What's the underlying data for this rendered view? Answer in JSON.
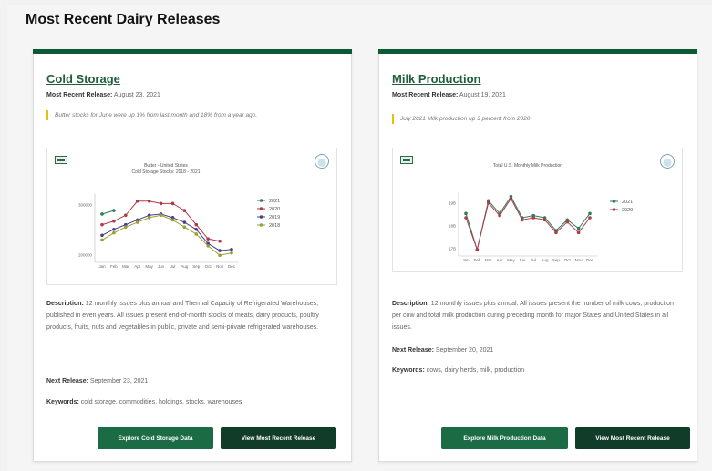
{
  "section": {
    "title": "Most Recent Dairy Releases"
  },
  "cards": [
    {
      "title": "Cold Storage",
      "release_label": "Most Recent Release:",
      "release_date": "August 23, 2021",
      "highlight": "Butter stocks for June were up 1% from last month and 18% from a year ago.",
      "description_label": "Description:",
      "description": "12 monthly issues plus annual and Thermal Capacity of Refrigerated Warehouses, published in even years. All issues present end-of-month stocks of meats, dairy products, poultry products, fruits, nuts and vegetables in public, private and semi-private refrigerated warehouses.",
      "next_release_label": "Next Release:",
      "next_release": "September 23, 2021",
      "keywords_label": "Keywords:",
      "keywords": "cold storage, commodities, holdings, stocks, warehouses",
      "explore_button": "Explore Cold Storage Data",
      "view_button": "View Most Recent Release"
    },
    {
      "title": "Milk Production",
      "release_label": "Most Recent Release:",
      "release_date": "August 19, 2021",
      "highlight": "July 2021 Milk production up 3 percent from 2020",
      "description_label": "Description:",
      "description": "12 monthly issues plus annual. All issues present the number of milk cows, production per cow and total milk production during preceding month for major States and United States in all issues.",
      "next_release_label": "Next Release:",
      "next_release": "September 20, 2021",
      "keywords_label": "Keywords:",
      "keywords": "cows, dairy herds, milk, production",
      "explore_button": "Explore Milk Production Data",
      "view_button": "View Most Recent Release"
    }
  ],
  "chart_data": [
    {
      "type": "line",
      "title": "Butter - United States",
      "subtitle": "Cold Storage Stocks: 2018 - 2021",
      "categories": [
        "Jan",
        "Feb",
        "Mar",
        "Apr",
        "May",
        "Jun",
        "Jul",
        "Aug",
        "Sep",
        "Oct",
        "Nov",
        "Dec"
      ],
      "y_ticks": [
        "300000",
        "200000"
      ],
      "series": [
        {
          "name": "2021",
          "color": "#2e7d5b",
          "values": [
            335,
            350,
            null,
            null,
            null,
            null,
            null,
            null,
            null,
            null,
            null,
            null
          ]
        },
        {
          "name": "2020",
          "color": "#b03a48",
          "values": [
            290,
            305,
            330,
            390,
            390,
            380,
            380,
            350,
            290,
            230,
            220,
            null
          ]
        },
        {
          "name": "2019",
          "color": "#4b3f8c",
          "values": [
            245,
            270,
            290,
            310,
            330,
            335,
            320,
            300,
            270,
            210,
            180,
            185
          ]
        },
        {
          "name": "2018",
          "color": "#9aa02f",
          "values": [
            225,
            255,
            280,
            300,
            320,
            330,
            310,
            280,
            250,
            200,
            160,
            170
          ]
        }
      ],
      "ylim": [
        130,
        420
      ],
      "legend": "right"
    },
    {
      "type": "line",
      "title": "Total U.S. Monthly Milk Production",
      "categories": [
        "Jan",
        "Feb",
        "Mar",
        "Apr",
        "May",
        "Jun",
        "Jul",
        "Aug",
        "Sep",
        "Oct",
        "Nov",
        "Dec"
      ],
      "y_ticks": [
        "19B",
        "18B",
        "17B"
      ],
      "series": [
        {
          "name": "2021",
          "color": "#2e7d5b",
          "values": [
            18.8,
            17.1,
            19.4,
            18.8,
            19.6,
            18.6,
            18.7,
            18.6,
            18.0,
            18.5,
            18.1,
            18.8
          ]
        },
        {
          "name": "2020",
          "color": "#b03a48",
          "values": [
            18.6,
            17.1,
            19.3,
            18.7,
            19.5,
            18.5,
            18.6,
            18.5,
            17.9,
            18.4,
            17.9,
            18.6
          ]
        }
      ],
      "ylim": [
        16.8,
        19.8
      ],
      "legend": "right"
    }
  ]
}
